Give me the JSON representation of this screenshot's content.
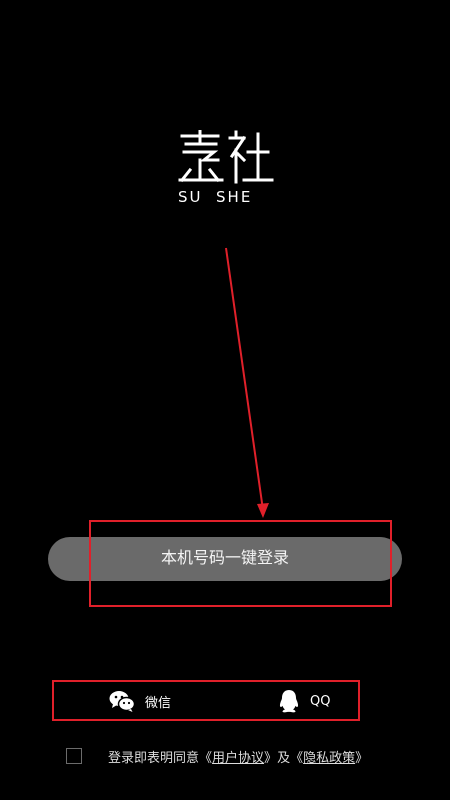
{
  "logo": {
    "latin": "SU  SHE"
  },
  "login": {
    "label": "本机号码一键登录"
  },
  "social": {
    "wechat_label": "微信",
    "qq_label": "QQ"
  },
  "agreement": {
    "prefix": "登录即表明同意",
    "quote_open_1": "《",
    "user_agreement": "用户协议",
    "quote_close_1": "》",
    "and": "及",
    "quote_open_2": "《",
    "privacy_policy": "隐私政策",
    "quote_close_2": "》"
  },
  "colors": {
    "background": "#000000",
    "button": "#6a6a6a",
    "annotation": "#e0202a"
  },
  "icons": {
    "wechat": "wechat-icon",
    "qq": "qq-penguin-icon",
    "arrow": "annotation-arrow-icon"
  }
}
